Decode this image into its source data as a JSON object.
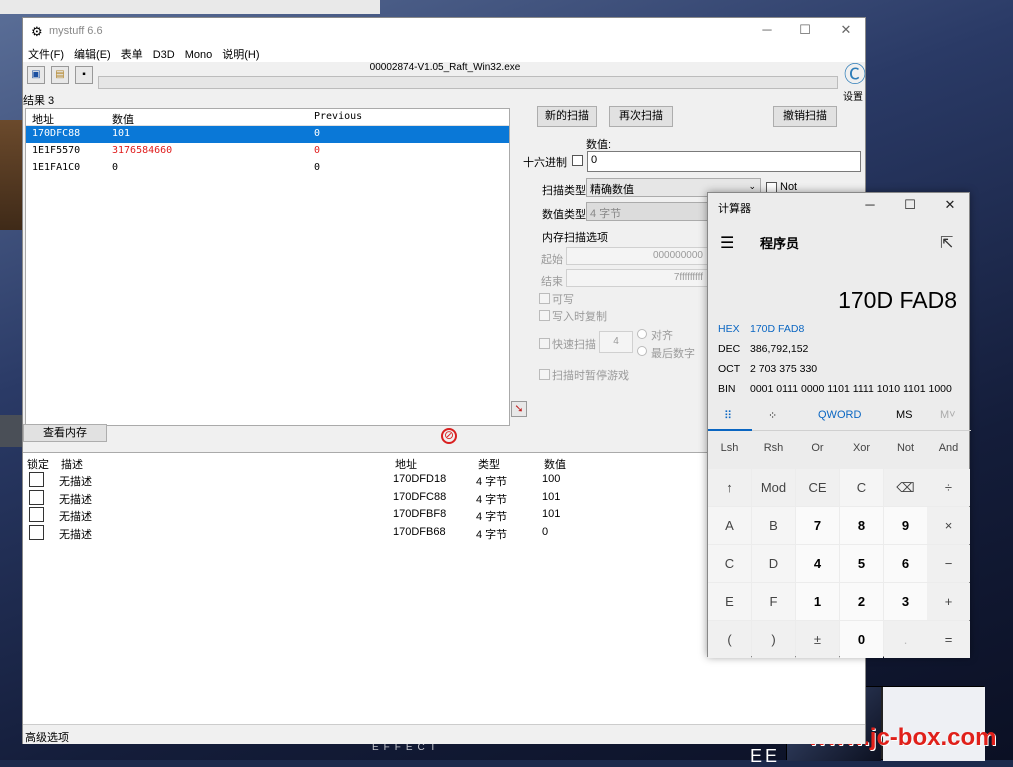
{
  "ce": {
    "title": "mystuff 6.6",
    "menu": [
      "文件(F)",
      "编辑(E)",
      "表单",
      "D3D",
      "Mono",
      "说明(H)"
    ],
    "process": "00002874-V1.05_Raft_Win32.exe",
    "settings_label": "设置",
    "found_label": "结果 3",
    "results_headers": [
      "地址",
      "数值",
      "Previous"
    ],
    "results": [
      {
        "address": "170DFC88",
        "value": "101",
        "previous": "0"
      },
      {
        "address": "1E1F5570",
        "value": "3176584660",
        "previous": "0"
      },
      {
        "address": "1E1FA1C0",
        "value": "0",
        "previous": "0"
      }
    ],
    "buttons": {
      "new_scan": "新的扫描",
      "next_scan": "再次扫描",
      "undo_scan": "撤销扫描",
      "view_memory": "查看内存"
    },
    "value_label": "数值:",
    "hex_label": "十六进制",
    "value_input": "0",
    "scan_type_label": "扫描类型",
    "scan_type": "精确数值",
    "not_label": "Not",
    "value_type_label": "数值类型",
    "value_type": "4 字节",
    "mem_options_label": "内存扫描选项",
    "start_label": "起始",
    "start_value": "000000000",
    "end_label": "结束",
    "end_value": "7fffffffff",
    "writable": "可写",
    "copy_on_write": "写入时复制",
    "fast_scan": "快速扫描",
    "fast_scan_value": "4",
    "align": "对齐",
    "last_digit": "最后数字",
    "pause_game": "扫描时暂停游戏",
    "addr_headers": [
      "锁定",
      "描述",
      "地址",
      "类型",
      "数值"
    ],
    "addr_rows": [
      {
        "desc": "无描述",
        "address": "170DFD18",
        "type": "4 字节",
        "value": "100"
      },
      {
        "desc": "无描述",
        "address": "170DFC88",
        "type": "4 字节",
        "value": "101"
      },
      {
        "desc": "无描述",
        "address": "170DFBF8",
        "type": "4 字节",
        "value": "101"
      },
      {
        "desc": "无描述",
        "address": "170DFB68",
        "type": "4 字节",
        "value": "0"
      }
    ],
    "status": "高级选项"
  },
  "calc": {
    "title": "计算器",
    "mode": "程序员",
    "display": "170D FAD8",
    "radix": [
      {
        "k": "HEX",
        "v": "170D FAD8"
      },
      {
        "k": "DEC",
        "v": "386,792,152"
      },
      {
        "k": "OCT",
        "v": "2 703 375 330"
      },
      {
        "k": "BIN",
        "v": "0001 0111 0000 1101 1111 1010 1101 1000"
      }
    ],
    "modebar": [
      "QWORD",
      "MS",
      "M˅"
    ],
    "fn_row": [
      "Lsh",
      "Rsh",
      "Or",
      "Xor",
      "Not",
      "And"
    ],
    "keys": [
      [
        "↑",
        "Mod",
        "CE",
        "C",
        "⌫",
        "÷"
      ],
      [
        "A",
        "B",
        "7",
        "8",
        "9",
        "×"
      ],
      [
        "C",
        "D",
        "4",
        "5",
        "6",
        "−"
      ],
      [
        "E",
        "F",
        "1",
        "2",
        "3",
        "+"
      ],
      [
        "(",
        ")",
        "±",
        "0",
        ".",
        "="
      ]
    ]
  },
  "desktop": {
    "bottom_text": "EFFECT",
    "bottom_text2": "EE",
    "watermark": "www.jc-box.com"
  }
}
